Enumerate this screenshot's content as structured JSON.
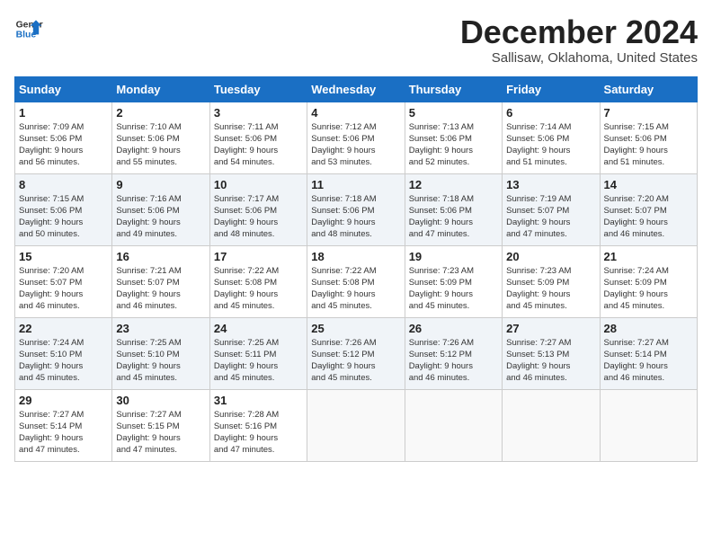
{
  "header": {
    "logo_line1": "General",
    "logo_line2": "Blue",
    "month": "December 2024",
    "location": "Sallisaw, Oklahoma, United States"
  },
  "days_of_week": [
    "Sunday",
    "Monday",
    "Tuesday",
    "Wednesday",
    "Thursday",
    "Friday",
    "Saturday"
  ],
  "weeks": [
    [
      {
        "day": "1",
        "info": "Sunrise: 7:09 AM\nSunset: 5:06 PM\nDaylight: 9 hours\nand 56 minutes."
      },
      {
        "day": "2",
        "info": "Sunrise: 7:10 AM\nSunset: 5:06 PM\nDaylight: 9 hours\nand 55 minutes."
      },
      {
        "day": "3",
        "info": "Sunrise: 7:11 AM\nSunset: 5:06 PM\nDaylight: 9 hours\nand 54 minutes."
      },
      {
        "day": "4",
        "info": "Sunrise: 7:12 AM\nSunset: 5:06 PM\nDaylight: 9 hours\nand 53 minutes."
      },
      {
        "day": "5",
        "info": "Sunrise: 7:13 AM\nSunset: 5:06 PM\nDaylight: 9 hours\nand 52 minutes."
      },
      {
        "day": "6",
        "info": "Sunrise: 7:14 AM\nSunset: 5:06 PM\nDaylight: 9 hours\nand 51 minutes."
      },
      {
        "day": "7",
        "info": "Sunrise: 7:15 AM\nSunset: 5:06 PM\nDaylight: 9 hours\nand 51 minutes."
      }
    ],
    [
      {
        "day": "8",
        "info": "Sunrise: 7:15 AM\nSunset: 5:06 PM\nDaylight: 9 hours\nand 50 minutes."
      },
      {
        "day": "9",
        "info": "Sunrise: 7:16 AM\nSunset: 5:06 PM\nDaylight: 9 hours\nand 49 minutes."
      },
      {
        "day": "10",
        "info": "Sunrise: 7:17 AM\nSunset: 5:06 PM\nDaylight: 9 hours\nand 48 minutes."
      },
      {
        "day": "11",
        "info": "Sunrise: 7:18 AM\nSunset: 5:06 PM\nDaylight: 9 hours\nand 48 minutes."
      },
      {
        "day": "12",
        "info": "Sunrise: 7:18 AM\nSunset: 5:06 PM\nDaylight: 9 hours\nand 47 minutes."
      },
      {
        "day": "13",
        "info": "Sunrise: 7:19 AM\nSunset: 5:07 PM\nDaylight: 9 hours\nand 47 minutes."
      },
      {
        "day": "14",
        "info": "Sunrise: 7:20 AM\nSunset: 5:07 PM\nDaylight: 9 hours\nand 46 minutes."
      }
    ],
    [
      {
        "day": "15",
        "info": "Sunrise: 7:20 AM\nSunset: 5:07 PM\nDaylight: 9 hours\nand 46 minutes."
      },
      {
        "day": "16",
        "info": "Sunrise: 7:21 AM\nSunset: 5:07 PM\nDaylight: 9 hours\nand 46 minutes."
      },
      {
        "day": "17",
        "info": "Sunrise: 7:22 AM\nSunset: 5:08 PM\nDaylight: 9 hours\nand 45 minutes."
      },
      {
        "day": "18",
        "info": "Sunrise: 7:22 AM\nSunset: 5:08 PM\nDaylight: 9 hours\nand 45 minutes."
      },
      {
        "day": "19",
        "info": "Sunrise: 7:23 AM\nSunset: 5:09 PM\nDaylight: 9 hours\nand 45 minutes."
      },
      {
        "day": "20",
        "info": "Sunrise: 7:23 AM\nSunset: 5:09 PM\nDaylight: 9 hours\nand 45 minutes."
      },
      {
        "day": "21",
        "info": "Sunrise: 7:24 AM\nSunset: 5:09 PM\nDaylight: 9 hours\nand 45 minutes."
      }
    ],
    [
      {
        "day": "22",
        "info": "Sunrise: 7:24 AM\nSunset: 5:10 PM\nDaylight: 9 hours\nand 45 minutes."
      },
      {
        "day": "23",
        "info": "Sunrise: 7:25 AM\nSunset: 5:10 PM\nDaylight: 9 hours\nand 45 minutes."
      },
      {
        "day": "24",
        "info": "Sunrise: 7:25 AM\nSunset: 5:11 PM\nDaylight: 9 hours\nand 45 minutes."
      },
      {
        "day": "25",
        "info": "Sunrise: 7:26 AM\nSunset: 5:12 PM\nDaylight: 9 hours\nand 45 minutes."
      },
      {
        "day": "26",
        "info": "Sunrise: 7:26 AM\nSunset: 5:12 PM\nDaylight: 9 hours\nand 46 minutes."
      },
      {
        "day": "27",
        "info": "Sunrise: 7:27 AM\nSunset: 5:13 PM\nDaylight: 9 hours\nand 46 minutes."
      },
      {
        "day": "28",
        "info": "Sunrise: 7:27 AM\nSunset: 5:14 PM\nDaylight: 9 hours\nand 46 minutes."
      }
    ],
    [
      {
        "day": "29",
        "info": "Sunrise: 7:27 AM\nSunset: 5:14 PM\nDaylight: 9 hours\nand 47 minutes."
      },
      {
        "day": "30",
        "info": "Sunrise: 7:27 AM\nSunset: 5:15 PM\nDaylight: 9 hours\nand 47 minutes."
      },
      {
        "day": "31",
        "info": "Sunrise: 7:28 AM\nSunset: 5:16 PM\nDaylight: 9 hours\nand 47 minutes."
      },
      {
        "day": "",
        "info": ""
      },
      {
        "day": "",
        "info": ""
      },
      {
        "day": "",
        "info": ""
      },
      {
        "day": "",
        "info": ""
      }
    ]
  ]
}
